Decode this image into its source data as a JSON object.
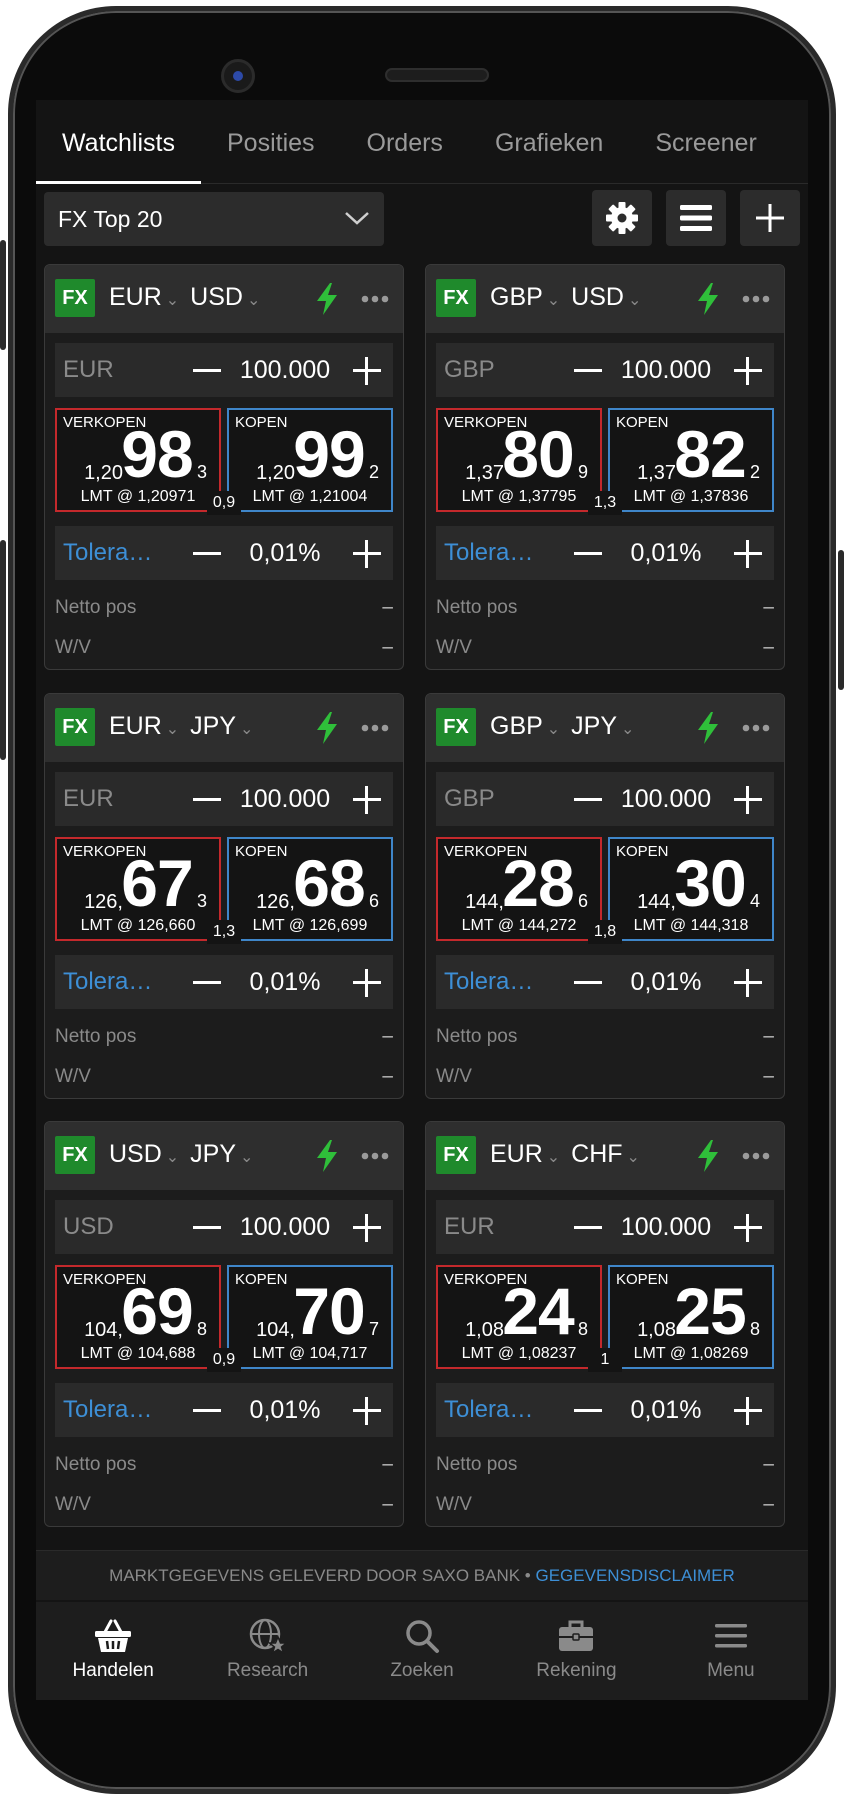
{
  "tabs": [
    {
      "label": "Watchlists"
    },
    {
      "label": "Posities"
    },
    {
      "label": "Orders"
    },
    {
      "label": "Grafieken"
    },
    {
      "label": "Screener"
    }
  ],
  "toolbar": {
    "watchlist_selected": "FX Top 20"
  },
  "cards": [
    {
      "badge": "FX",
      "base": "EUR",
      "quote": "USD",
      "amount_ccy": "EUR",
      "amount": "100.000",
      "sell": {
        "label": "VERKOPEN",
        "prefix": "1,20",
        "big": "98",
        "pip": "3",
        "limit": "LMT @ 1,20971"
      },
      "buy": {
        "label": "KOPEN",
        "prefix": "1,20",
        "big": "99",
        "pip": "2",
        "limit": "LMT @ 1,21004"
      },
      "spread": "0,9",
      "tol_label": "Tolera…",
      "tolerance": "0,01%",
      "net_label": "Netto pos",
      "net_value": "–",
      "pl_label": "W/V",
      "pl_value": "–"
    },
    {
      "badge": "FX",
      "base": "GBP",
      "quote": "USD",
      "amount_ccy": "GBP",
      "amount": "100.000",
      "sell": {
        "label": "VERKOPEN",
        "prefix": "1,37",
        "big": "80",
        "pip": "9",
        "limit": "LMT @ 1,37795"
      },
      "buy": {
        "label": "KOPEN",
        "prefix": "1,37",
        "big": "82",
        "pip": "2",
        "limit": "LMT @ 1,37836"
      },
      "spread": "1,3",
      "tol_label": "Tolera…",
      "tolerance": "0,01%",
      "net_label": "Netto pos",
      "net_value": "–",
      "pl_label": "W/V",
      "pl_value": "–"
    },
    {
      "badge": "FX",
      "base": "EUR",
      "quote": "JPY",
      "amount_ccy": "EUR",
      "amount": "100.000",
      "sell": {
        "label": "VERKOPEN",
        "prefix": "126,",
        "big": "67",
        "pip": "3",
        "limit": "LMT @ 126,660"
      },
      "buy": {
        "label": "KOPEN",
        "prefix": "126,",
        "big": "68",
        "pip": "6",
        "limit": "LMT @ 126,699"
      },
      "spread": "1,3",
      "tol_label": "Tolera…",
      "tolerance": "0,01%",
      "net_label": "Netto pos",
      "net_value": "–",
      "pl_label": "W/V",
      "pl_value": "–"
    },
    {
      "badge": "FX",
      "base": "GBP",
      "quote": "JPY",
      "amount_ccy": "GBP",
      "amount": "100.000",
      "sell": {
        "label": "VERKOPEN",
        "prefix": "144,",
        "big": "28",
        "pip": "6",
        "limit": "LMT @ 144,272"
      },
      "buy": {
        "label": "KOPEN",
        "prefix": "144,",
        "big": "30",
        "pip": "4",
        "limit": "LMT @ 144,318"
      },
      "spread": "1,8",
      "tol_label": "Tolera…",
      "tolerance": "0,01%",
      "net_label": "Netto pos",
      "net_value": "–",
      "pl_label": "W/V",
      "pl_value": "–"
    },
    {
      "badge": "FX",
      "base": "USD",
      "quote": "JPY",
      "amount_ccy": "USD",
      "amount": "100.000",
      "sell": {
        "label": "VERKOPEN",
        "prefix": "104,",
        "big": "69",
        "pip": "8",
        "limit": "LMT @ 104,688"
      },
      "buy": {
        "label": "KOPEN",
        "prefix": "104,",
        "big": "70",
        "pip": "7",
        "limit": "LMT @ 104,717"
      },
      "spread": "0,9",
      "tol_label": "Tolera…",
      "tolerance": "0,01%",
      "net_label": "Netto pos",
      "net_value": "–",
      "pl_label": "W/V",
      "pl_value": "–"
    },
    {
      "badge": "FX",
      "base": "EUR",
      "quote": "CHF",
      "amount_ccy": "EUR",
      "amount": "100.000",
      "sell": {
        "label": "VERKOPEN",
        "prefix": "1,08",
        "big": "24",
        "pip": "8",
        "limit": "LMT @ 1,08237"
      },
      "buy": {
        "label": "KOPEN",
        "prefix": "1,08",
        "big": "25",
        "pip": "8",
        "limit": "LMT @ 1,08269"
      },
      "spread": "1",
      "tol_label": "Tolera…",
      "tolerance": "0,01%",
      "net_label": "Netto pos",
      "net_value": "–",
      "pl_label": "W/V",
      "pl_value": "–"
    }
  ],
  "disclaimer": {
    "text": "MARKTGEGEVENS GELEVERD DOOR SAXO BANK •",
    "link": "GEGEVENSDISCLAIMER"
  },
  "bottom_nav": [
    {
      "label": "Handelen",
      "icon": "basket-icon"
    },
    {
      "label": "Research",
      "icon": "globe-star-icon"
    },
    {
      "label": "Zoeken",
      "icon": "search-icon"
    },
    {
      "label": "Rekening",
      "icon": "briefcase-icon"
    },
    {
      "label": "Menu",
      "icon": "menu-icon"
    }
  ],
  "colors": {
    "background": "#141414",
    "card": "#1c1c1c",
    "sell_border": "#c4292c",
    "buy_border": "#3f86c9",
    "fx_badge": "#1f8a2c",
    "link_blue": "#3d8fd6",
    "bolt_green": "#2fbf3a"
  }
}
